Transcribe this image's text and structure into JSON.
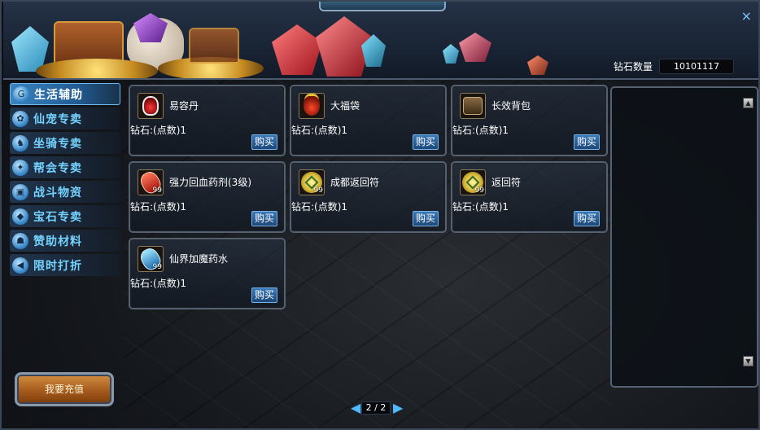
{
  "header": {
    "diamond_label": "钻石数量",
    "diamond_value": "10101117",
    "close_icon": "×"
  },
  "sidebar": {
    "items": [
      {
        "label": "生活辅助",
        "icon": "G",
        "active": true
      },
      {
        "label": "仙宠专卖",
        "icon": "✿",
        "active": false
      },
      {
        "label": "坐骑专卖",
        "icon": "♞",
        "active": false
      },
      {
        "label": "帮会专卖",
        "icon": "✦",
        "active": false
      },
      {
        "label": "战斗物资",
        "icon": "▣",
        "active": false
      },
      {
        "label": "宝石专卖",
        "icon": "◆",
        "active": false
      },
      {
        "label": "赞助材料",
        "icon": "☗",
        "active": false
      },
      {
        "label": "限时打折",
        "icon": "◀",
        "active": false
      }
    ],
    "recharge_label": "我要充值"
  },
  "products": [
    {
      "name": "易容丹",
      "price": "钻石:(点数)1",
      "buy": "购买",
      "qty": "",
      "icon": "red-potion-icon"
    },
    {
      "name": "大福袋",
      "price": "钻石:(点数)1",
      "buy": "购买",
      "qty": "",
      "icon": "lucky-bag-icon"
    },
    {
      "name": "长效背包",
      "price": "钻石:(点数)1",
      "buy": "购买",
      "qty": "",
      "icon": "backpack-icon"
    },
    {
      "name": "强力回血药剂(3级)",
      "price": "钻石:(点数)1",
      "buy": "购买",
      "qty": "99",
      "icon": "health-potion-icon"
    },
    {
      "name": "成都返回符",
      "price": "钻石:(点数)1",
      "buy": "购买",
      "qty": "99",
      "icon": "talisman-icon"
    },
    {
      "name": "返回符",
      "price": "钻石:(点数)1",
      "buy": "购买",
      "qty": "99",
      "icon": "talisman-icon"
    },
    {
      "name": "仙界加魔药水",
      "price": "钻石:(点数)1",
      "buy": "购买",
      "qty": "99",
      "icon": "mana-potion-icon"
    }
  ],
  "pager": {
    "text": "2 / 2",
    "prev": "◀",
    "next": "▶"
  },
  "scroll": {
    "up": "▲",
    "down": "▼"
  }
}
